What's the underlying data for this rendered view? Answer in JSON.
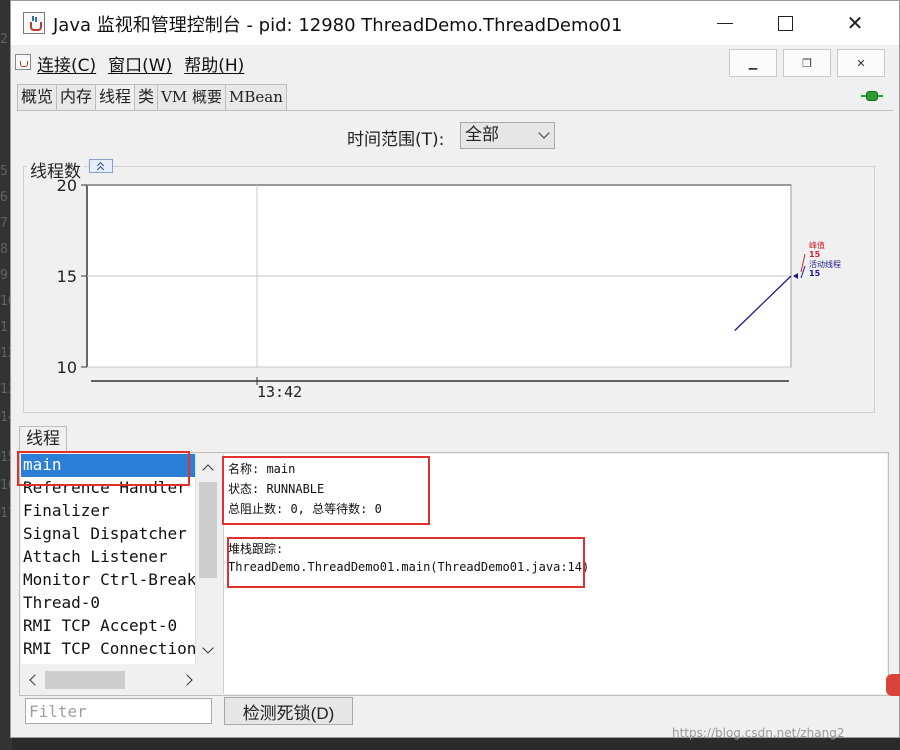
{
  "background": {
    "gutter_numbers": [
      "2",
      "5",
      "6",
      "7",
      "8",
      "9",
      "10",
      "11",
      "12",
      "13",
      "14",
      "15",
      "16",
      "17"
    ]
  },
  "window": {
    "title": "Java 监视和管理控制台 - pid: 12980 ThreadDemo.ThreadDemo01"
  },
  "menu": {
    "items": [
      "连接(C)",
      "窗口(W)",
      "帮助(H)"
    ]
  },
  "tabs": [
    "概览",
    "内存",
    "线程",
    "类",
    "VM 概要",
    "MBean"
  ],
  "time_range": {
    "label": "时间范围(T):",
    "selected": "全部"
  },
  "chart_title": "线程数",
  "chart_data": {
    "type": "line",
    "title": "线程数",
    "x_ticks": [
      "13:42"
    ],
    "y_ticks": [
      10,
      15,
      20
    ],
    "ylim": [
      10,
      20
    ],
    "series": [
      {
        "name": "峰值",
        "color": "#d2222d",
        "value": 15
      },
      {
        "name": "活动线程",
        "color": "#1a1a8c",
        "value": 15,
        "points": [
          [
            0.92,
            12
          ],
          [
            1.0,
            15
          ]
        ]
      }
    ],
    "legend": [
      {
        "label": "峰值",
        "value": "15",
        "color": "#d2222d"
      },
      {
        "label": "活动线程",
        "value": "15",
        "color": "#1a1a8c"
      }
    ]
  },
  "threads": {
    "tab_label": "线程",
    "list": [
      "main",
      "Reference Handler",
      "Finalizer",
      "Signal Dispatcher",
      "Attach Listener",
      "Monitor Ctrl-Break",
      "Thread-0",
      "RMI TCP Accept-0",
      "RMI TCP Connection("
    ],
    "selected": "main",
    "details": {
      "name_line": "名称: main",
      "state_line": "状态: RUNNABLE",
      "counts_line": "总阻止数: 0, 总等待数: 0",
      "stack_label": "堆栈跟踪:",
      "stack_line": "ThreadDemo.ThreadDemo01.main(ThreadDemo01.java:14)"
    },
    "filter_placeholder": "Filter",
    "deadlock_button": "检测死锁(D)"
  },
  "watermark": "https://blog.csdn.net/zhang2"
}
